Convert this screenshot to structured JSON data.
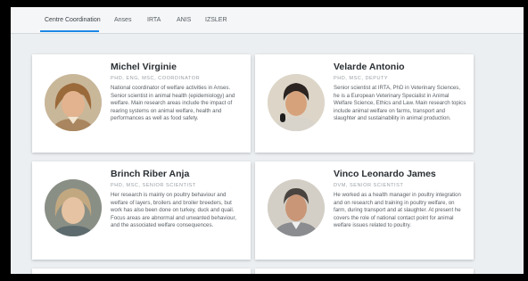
{
  "tabs": [
    {
      "label": "Centre Coordination",
      "active": true
    },
    {
      "label": "Anses",
      "active": false
    },
    {
      "label": "IRTA",
      "active": false
    },
    {
      "label": "ANIS",
      "active": false
    },
    {
      "label": "IZSLER",
      "active": false
    }
  ],
  "accent_color": "#1e88e5",
  "people": [
    {
      "name": "Michel Virginie",
      "role": "PHD, ENG, MSC, COORDINATOR",
      "bio": "National coordinator of welfare activities in Anses. Senior scientist in animal health (epidemiology) and welfare. Main research areas include the impact of rearing systems on animal welfare, health and performances as well as food safety."
    },
    {
      "name": "Velarde Antonio",
      "role": "PHD, MSC, DEPUTY",
      "bio": "Senior scientist at IRTA, PhD in Veterinary Sciences, he is a European Veterinary Specialist in Animal Welfare Science, Ethics and Law. Main research topics include animal welfare on farms, transport and slaughter and sustainability in animal production."
    },
    {
      "name": "Brinch Riber Anja",
      "role": "PHD, MSC, SENIOR SCIENTIST",
      "bio": "Her research is mainly on poultry behaviour and welfare of layers, broilers and broiler breeders, but work has also been done on turkey, duck and quail. Focus areas are abnormal and unwanted behaviour, and the associated welfare consequences."
    },
    {
      "name": "Vinco  Leonardo James",
      "role": "DVM, SENIOR SCIENTIST",
      "bio": "He worked as a health manager in poultry integration and on research and training in poultry welfare, on farm, during transport and at slaughter. At present he covers the role of national contact point for animal welfare issues related to poultry."
    }
  ]
}
